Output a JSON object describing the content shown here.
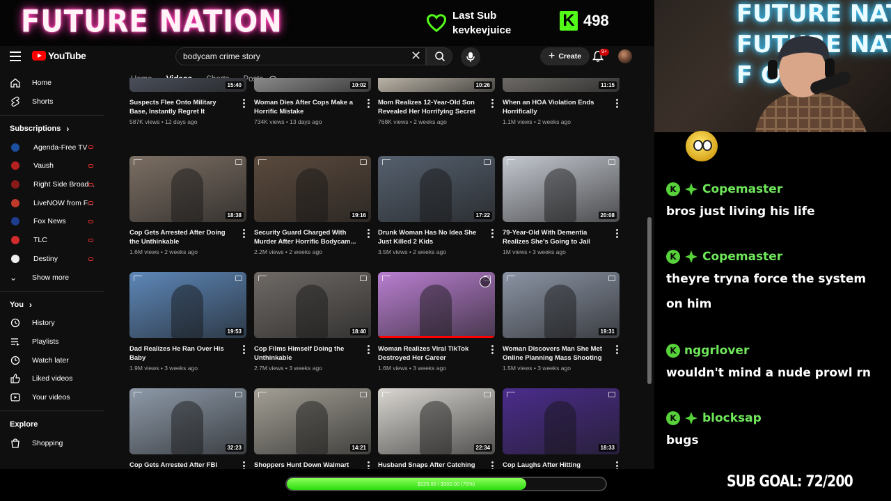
{
  "stream": {
    "brand": "FUTURE NATION",
    "last_sub_label": "Last Sub",
    "last_sub_user": "kevkevjuice",
    "kick_count": "498",
    "cam_neon_lines": [
      "FUTURE NATION",
      "FUTURE NATION",
      "F            ON"
    ],
    "sub_bar_text": "$225.00 / $300.00 (75%)",
    "sub_bar_progress": 0.75,
    "sub_goal": "SUB GOAL: 72/200",
    "colors": {
      "kick_green": "#53fc18",
      "chat_name": "#6fe85a",
      "neon_pink": "#ff3bb0",
      "neon_blue": "#39c6ff"
    }
  },
  "youtube": {
    "logo_text": "YouTube",
    "search_value": "bodycam crime story",
    "create_label": "Create",
    "bell_badge": "9+",
    "tabs": [
      "Home",
      "Videos",
      "Shorts",
      "Posts"
    ],
    "active_tab": "Videos",
    "nav": [
      {
        "label": "Home",
        "icon": "home-icon"
      },
      {
        "label": "Shorts",
        "icon": "shorts-icon"
      }
    ],
    "subscriptions_header": "Subscriptions",
    "subscriptions": [
      {
        "label": "Agenda-Free TV",
        "color": "#1d4fa0"
      },
      {
        "label": "Vaush",
        "color": "#b52020"
      },
      {
        "label": "Right Side Broad...",
        "color": "#8a1a1a"
      },
      {
        "label": "LiveNOW from F...",
        "color": "#c0392b"
      },
      {
        "label": "Fox News",
        "color": "#1e3d8f"
      },
      {
        "label": "TLC",
        "color": "#d22b2b"
      },
      {
        "label": "Destiny",
        "color": "#eeeeee"
      }
    ],
    "show_more": "Show more",
    "you_header": "You",
    "you_items": [
      {
        "label": "History",
        "icon": "history-icon"
      },
      {
        "label": "Playlists",
        "icon": "playlists-icon"
      },
      {
        "label": "Watch later",
        "icon": "watch-later-icon"
      },
      {
        "label": "Liked videos",
        "icon": "liked-videos-icon"
      },
      {
        "label": "Your videos",
        "icon": "your-videos-icon"
      }
    ],
    "explore_header": "Explore",
    "explore_items": [
      {
        "label": "Shopping",
        "icon": "shopping-icon"
      }
    ],
    "rows": [
      [
        {
          "title": "Suspects Flee Onto Military Base, Instantly Regret It",
          "meta": "587K views • 12 days ago",
          "duration": "15:40"
        },
        {
          "title": "Woman Dies After Cops Make a Horrific Mistake",
          "meta": "734K views • 13 days ago",
          "duration": "10:02"
        },
        {
          "title": "Mom Realizes 12-Year-Old Son Revealed Her Horrifying Secret",
          "meta": "768K views • 2 weeks ago",
          "duration": "10:26"
        },
        {
          "title": "When an HOA Violation Ends Horrifically",
          "meta": "1.1M views • 2 weeks ago",
          "duration": "11:15"
        }
      ],
      [
        {
          "title": "Cop Gets Arrested After Doing the Unthinkable",
          "meta": "1.6M views • 2 weeks ago",
          "duration": "18:38"
        },
        {
          "title": "Security Guard Charged With Murder After Horrific Bodycam...",
          "meta": "2.2M views • 2 weeks ago",
          "duration": "19:16"
        },
        {
          "title": "Drunk Woman Has No Idea She Just Killed 2 Kids",
          "meta": "3.5M views • 2 weeks ago",
          "duration": "17:22"
        },
        {
          "title": "79-Year-Old With Dementia Realizes She's Going to Jail",
          "meta": "1M views • 3 weeks ago",
          "duration": "20:08"
        }
      ],
      [
        {
          "title": "Dad Realizes He Ran Over His Baby",
          "meta": "1.9M views • 3 weeks ago",
          "duration": "19:53"
        },
        {
          "title": "Cop Films Himself Doing the Unthinkable",
          "meta": "2.7M views • 3 weeks ago",
          "duration": "18:40"
        },
        {
          "title": "Woman Realizes Viral TikTok Destroyed Her Career",
          "meta": "1.6M views • 3 weeks ago",
          "duration": ""
        },
        {
          "title": "Woman Discovers Man She Met Online Planning Mass Shooting",
          "meta": "1.5M views • 3 weeks ago",
          "duration": "19:31"
        }
      ],
      [
        {
          "title": "Cop Gets Arrested After FBI",
          "meta": "",
          "duration": "32:23"
        },
        {
          "title": "Shoppers Hunt Down Walmart Killer",
          "meta": "",
          "duration": "14:21"
        },
        {
          "title": "Husband Snaps After Catching Wife",
          "meta": "",
          "duration": "22:34"
        },
        {
          "title": "Cop Laughs After Hitting",
          "meta": "",
          "duration": "18:33"
        }
      ]
    ]
  },
  "chat": {
    "messages": [
      {
        "user": "Copemaster",
        "text": "bros just living his life",
        "badges": [
          "kick-badge",
          "gift-badge"
        ]
      },
      {
        "user": "Copemaster",
        "text": "theyre tryna force the system on him",
        "badges": [
          "kick-badge",
          "gift-badge"
        ]
      },
      {
        "user": "nggrlover",
        "text": "wouldn't mind a nude prowl rn",
        "badges": [
          "kick-badge"
        ]
      },
      {
        "user": "blocksap",
        "text": "bugs",
        "badges": [
          "kick-badge",
          "gift-badge"
        ]
      }
    ]
  }
}
